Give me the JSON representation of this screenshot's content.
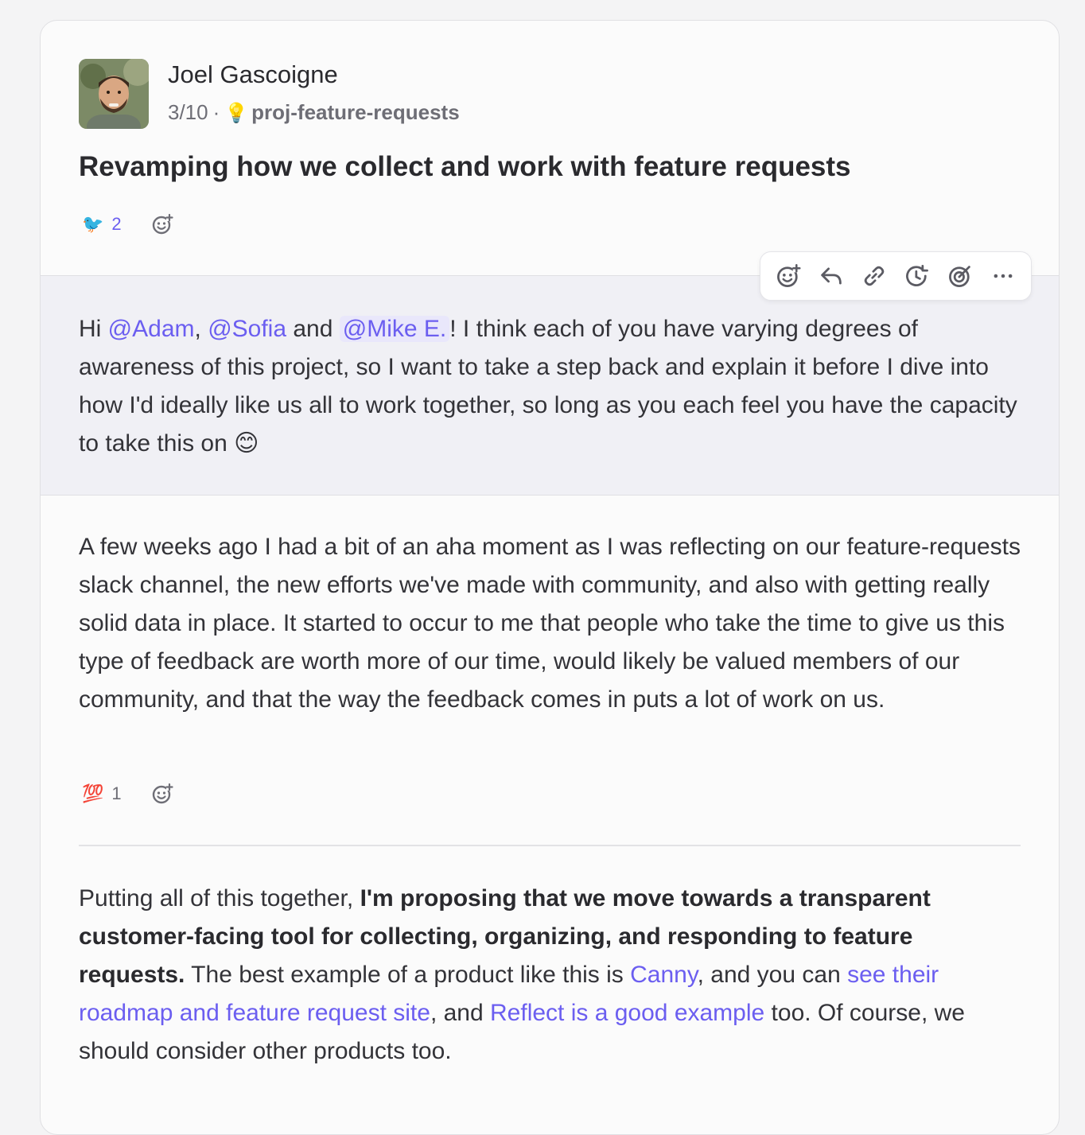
{
  "post": {
    "author": "Joel Gascoigne",
    "date": "3/10",
    "separator": "·",
    "channel_icon": "💡",
    "channel": "proj-feature-requests",
    "title": "Revamping how we collect and work with feature requests",
    "reaction": {
      "emoji": "🐦",
      "count": "2"
    }
  },
  "toolbar": {
    "icons": [
      "add-reaction-icon",
      "reply-icon",
      "link-icon",
      "remind-icon",
      "focus-target-icon",
      "more-icon"
    ]
  },
  "message1": {
    "hi": "Hi ",
    "mention1": "@Adam",
    "comma": ",",
    "mention2": "@Sofia",
    "and": "and",
    "mention3": "@Mike E.",
    "text": "! I think each of you have varying degrees of awareness of this project, so I want to take a step back and explain it before I dive into how I'd ideally like us all to work together, so long as you each feel you have the capacity to take this on",
    "emoji": "😊"
  },
  "message2": {
    "text": "A few weeks ago I had a bit of an aha moment as I was reflecting on our feature-requests slack channel, the new efforts we've made with community, and also with getting really solid data in place. It started to occur to me that people who take the time to give us this type of feedback are worth more of our time, would likely be valued members of our community, and that the way the feedback comes in puts a lot of work on us.",
    "reaction": {
      "emoji": "💯",
      "count": "1"
    }
  },
  "message3": {
    "intro": "Putting all of this together, ",
    "bold": "I'm proposing that we move towards a transparent customer-facing tool for collecting, organizing, and responding to feature requests.",
    "mid1": " The best example of a product like this is ",
    "link1": "Canny",
    "mid2": ", and you can ",
    "link2": "see their roadmap and feature request site",
    "mid3": ", and ",
    "link3": "Reflect is a good example",
    "end": " too. Of course, we should consider other products too."
  },
  "colors": {
    "accent": "#6b5ef0",
    "highlight_bg": "#f0f0f5",
    "text": "#333338"
  }
}
